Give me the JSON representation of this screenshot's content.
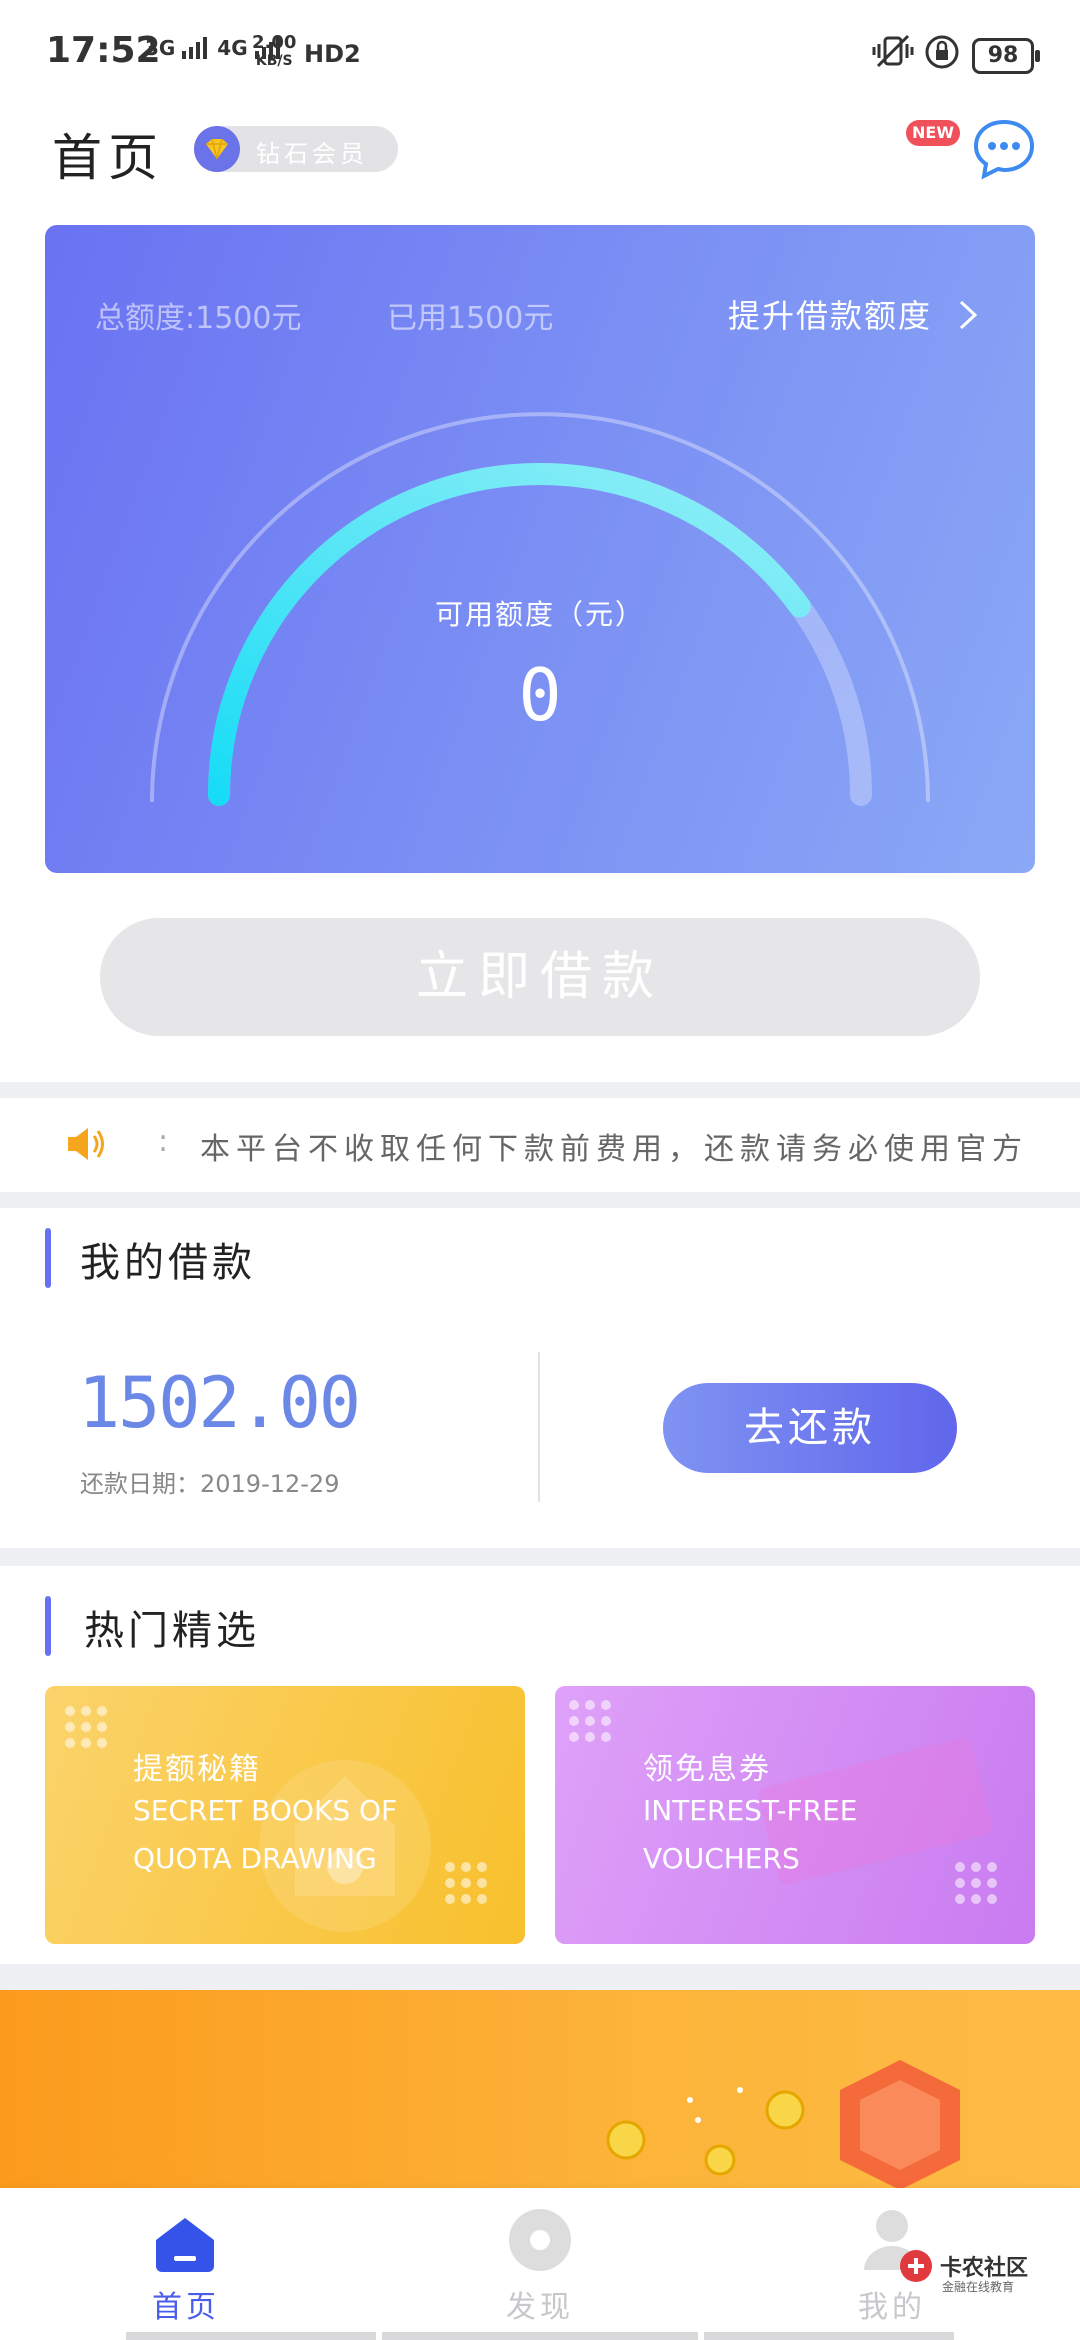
{
  "status_bar": {
    "time": "17:52",
    "network_1": "3G",
    "network_2": "4G",
    "speed_value": "2.00",
    "speed_unit": "KB/S",
    "hd": "HD2",
    "battery": "98"
  },
  "header": {
    "title": "首页",
    "member_badge": "钻石会员",
    "new_tag": "NEW"
  },
  "credit": {
    "total_label": "总额度:1500元",
    "used_label": "已用1500元",
    "raise_link": "提升借款额度",
    "available_label": "可用额度（元）",
    "available_value": "0",
    "gauge_fill_fraction": 0.8
  },
  "borrow_button": "立即借款",
  "notice": {
    "text": "本平台不收取任何下款前费用，还款请务必使用官方"
  },
  "my_loan": {
    "title": "我的借款",
    "amount": "1502.00",
    "due_date": "还款日期：2019-12-29",
    "repay_button": "去还款"
  },
  "hot": {
    "title": "热门精选",
    "cards": [
      {
        "cn": "提额秘籍",
        "en_line1": "SECRET BOOKS OF",
        "en_line2": "QUOTA DRAWING"
      },
      {
        "cn": "领免息券",
        "en_line1": "INTEREST-FREE",
        "en_line2": "VOUCHERS"
      }
    ]
  },
  "tabs": [
    {
      "label": "首页"
    },
    {
      "label": "发现"
    },
    {
      "label": "我的"
    }
  ],
  "watermark": {
    "name": "卡农社区",
    "sub": "金融在线教育"
  },
  "colors": {
    "accent": "#6670f0",
    "card_gradient_start": "#6a72f2",
    "card_gradient_end": "#8aa8f6",
    "gauge_fill": "#36e0f0"
  }
}
